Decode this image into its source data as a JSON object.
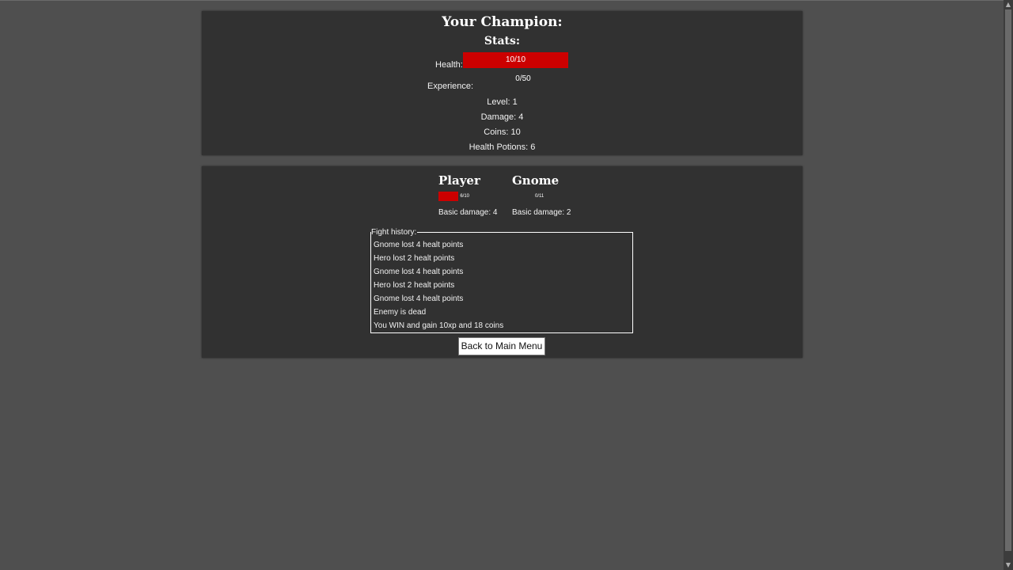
{
  "stats": {
    "title": "Your Champion:",
    "subtitle": "Stats:",
    "health_label": "Health:",
    "health_value": "10/10",
    "health_fraction": 1.0,
    "experience_label": "Experience:",
    "experience_value": "0/50",
    "experience_fraction": 0.0,
    "level": "Level: 1",
    "damage": "Damage: 4",
    "coins": "Coins: 10",
    "potions": "Health Potions: 6"
  },
  "fight": {
    "player": {
      "name": "Player",
      "health_value": "6/10",
      "health_fraction": 0.6,
      "damage": "Basic damage: 4"
    },
    "enemy": {
      "name": "Gnome",
      "health_value": "0/11",
      "health_fraction": 0.0,
      "damage": "Basic damage: 2"
    },
    "history_label": "Fight history:",
    "history": [
      "Gnome lost 4 healt points",
      "Hero lost 2 healt points",
      "Gnome lost 4 healt points",
      "Hero lost 2 healt points",
      "Gnome lost 4 healt points",
      "Enemy is dead",
      "You WIN and gain 10xp and 18 coins"
    ],
    "back_button": "Back to Main Menu"
  },
  "colors": {
    "background": "#4f4f4f",
    "panel": "#313131",
    "health": "#cc0000"
  }
}
